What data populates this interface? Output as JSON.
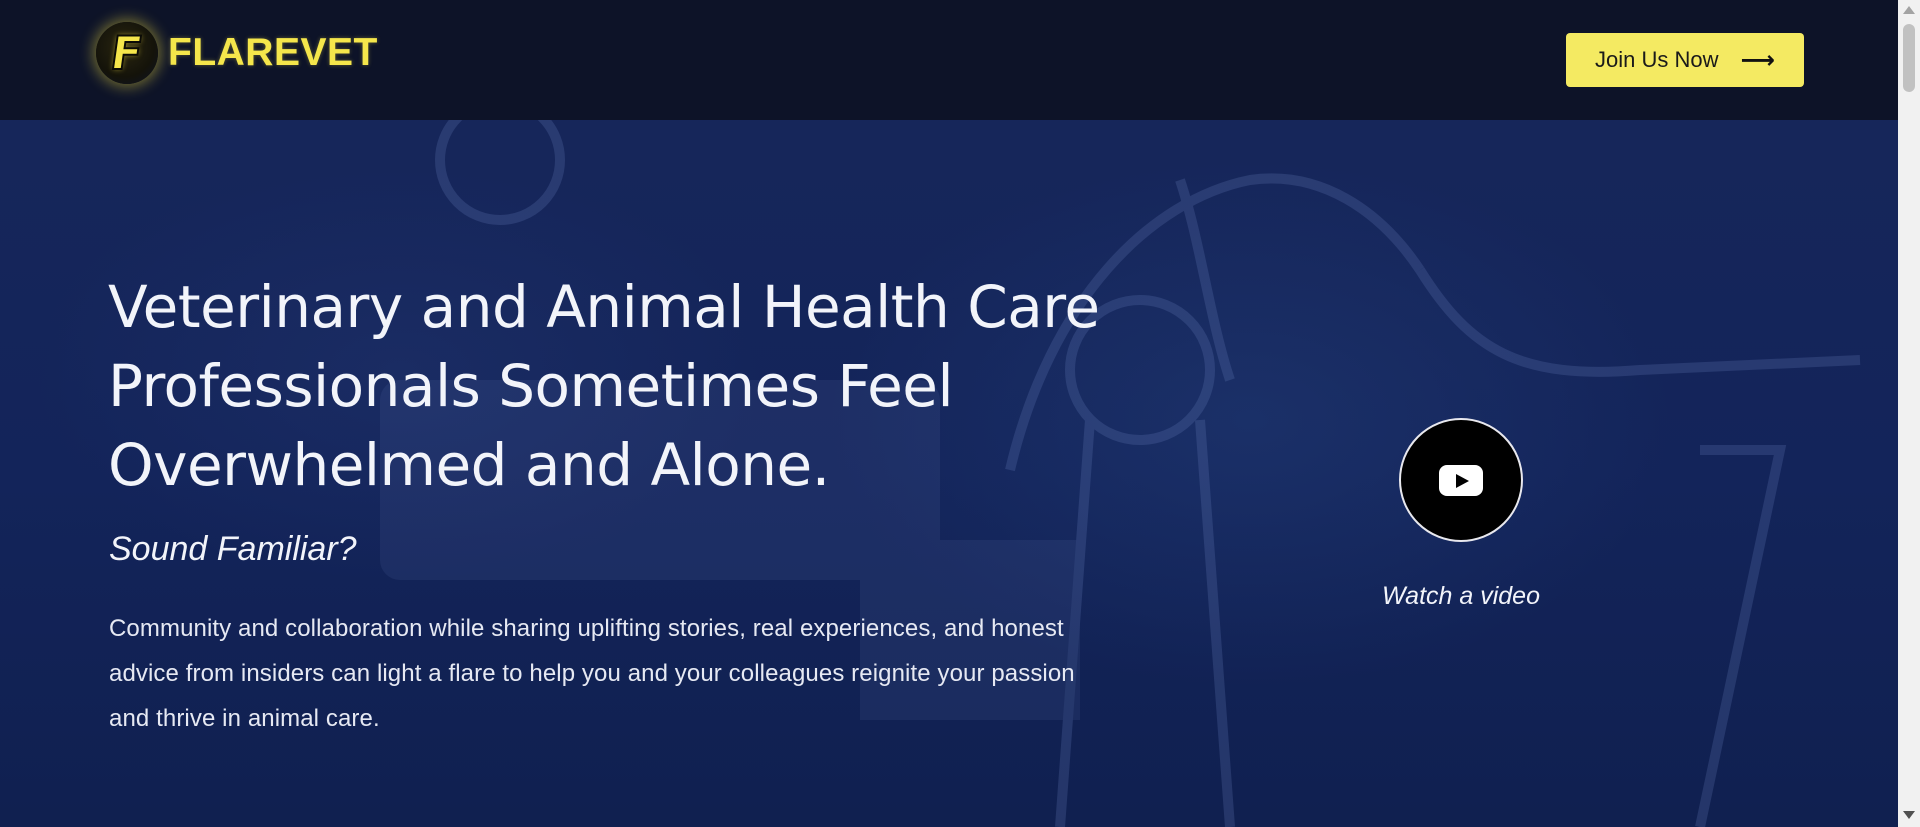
{
  "header": {
    "logo_letter": "F",
    "brand_name": "FLAREVET",
    "cta_label": "Join Us Now",
    "cta_icon": "arrow-right-icon"
  },
  "hero": {
    "headline": "Veterinary and Animal Health Care Professionals Sometimes Feel Overwhelmed and Alone.",
    "subhead": "Sound Familiar?",
    "body": "Community and collaboration while sharing  uplifting stories, real experiences, and honest advice from insiders can light a flare to help you and your colleagues reignite your passion and thrive in animal care.",
    "video_icon": "youtube-play-icon",
    "video_label": "Watch a video"
  },
  "colors": {
    "header_bg": "#0d1328",
    "hero_bg": "#13245a",
    "accent_yellow": "#f4ea62",
    "text_light": "#f2f4fa"
  }
}
